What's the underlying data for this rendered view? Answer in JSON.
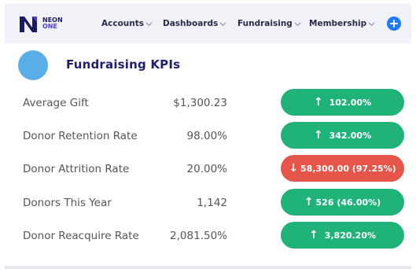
{
  "brand": {
    "line1": "NEON",
    "line2": "ONE"
  },
  "nav": {
    "items": [
      {
        "label": "Accounts"
      },
      {
        "label": "Dashboards"
      },
      {
        "label": "Fundraising"
      },
      {
        "label": "Membership"
      }
    ]
  },
  "panel": {
    "title": "Fundraising KPIs"
  },
  "colors": {
    "positive": "#1fb37a",
    "negative": "#e55549",
    "accent": "#1e7bff",
    "avatar": "#5aaee8"
  },
  "kpis": [
    {
      "label": "Average Gift",
      "value": "$1,300.23",
      "change": "102.00%",
      "direction": "up",
      "status": "positive"
    },
    {
      "label": "Donor Retention Rate",
      "value": "98.00%",
      "change": "342.00%",
      "direction": "up",
      "status": "positive"
    },
    {
      "label": "Donor Attrition Rate",
      "value": "20.00%",
      "change": "58,300.00 (97.25%)",
      "direction": "down",
      "status": "negative"
    },
    {
      "label": "Donors This Year",
      "value": "1,142",
      "change": "526 (46.00%)",
      "direction": "up",
      "status": "positive"
    },
    {
      "label": "Donor Reacquire Rate",
      "value": "2,081.50%",
      "change": "3,820.20%",
      "direction": "up",
      "status": "positive"
    }
  ]
}
